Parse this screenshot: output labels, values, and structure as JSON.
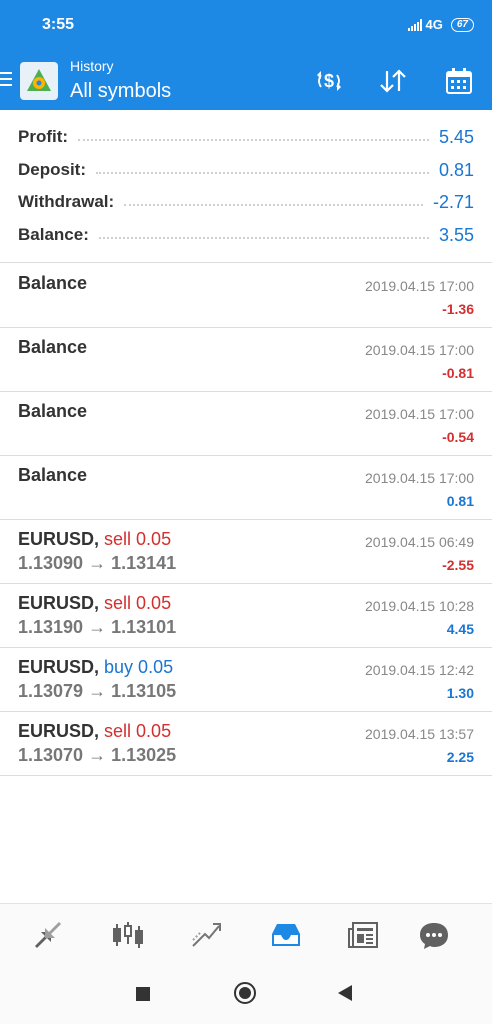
{
  "status_bar": {
    "time": "3:55",
    "network": "4G",
    "battery": "67"
  },
  "app_bar": {
    "subtitle": "History",
    "title": "All symbols",
    "actions": [
      "currency-exchange-icon",
      "sort-icon",
      "calendar-icon"
    ]
  },
  "summary": {
    "profit": {
      "label": "Profit:",
      "value": "5.45"
    },
    "deposit": {
      "label": "Deposit:",
      "value": "0.81"
    },
    "withdrawal": {
      "label": "Withdrawal:",
      "value": "-2.71"
    },
    "balance": {
      "label": "Balance:",
      "value": "3.55"
    }
  },
  "deals": [
    {
      "name": "Balance",
      "time": "2019.04.15 17:00",
      "amount": "-1.36"
    },
    {
      "name": "Balance",
      "time": "2019.04.15 17:00",
      "amount": "-0.81"
    },
    {
      "name": "Balance",
      "time": "2019.04.15 17:00",
      "amount": "-0.54"
    },
    {
      "name": "Balance",
      "time": "2019.04.15 17:00",
      "amount": "0.81"
    }
  ],
  "trades": [
    {
      "symbol": "EURUSD,",
      "side": "sell 0.05",
      "prices": "1.13090 → 1.13141",
      "time": "2019.04.15 06:49",
      "amount": "-2.55"
    },
    {
      "symbol": "EURUSD,",
      "side": "sell 0.05",
      "prices": "1.13190 → 1.13101",
      "time": "2019.04.15 10:28",
      "amount": "4.45"
    },
    {
      "symbol": "EURUSD,",
      "side": "buy 0.05",
      "prices": "1.13079 → 1.13105",
      "time": "2019.04.15 12:42",
      "amount": "1.30"
    },
    {
      "symbol": "EURUSD,",
      "side": "sell 0.05",
      "prices": "1.13070 → 1.13025",
      "time": "2019.04.15 13:57",
      "amount": "2.25"
    }
  ],
  "bottom_nav": {
    "items": [
      "quotes-icon",
      "chart-icon",
      "trade-icon",
      "history-icon",
      "news-icon",
      "messages-icon"
    ],
    "active": "history-icon"
  },
  "system_nav": [
    "recents-icon",
    "home-icon",
    "back-icon"
  ],
  "colors": {
    "accent": "#1e88e5",
    "positive": "#1976d2",
    "negative": "#d32f2f"
  }
}
